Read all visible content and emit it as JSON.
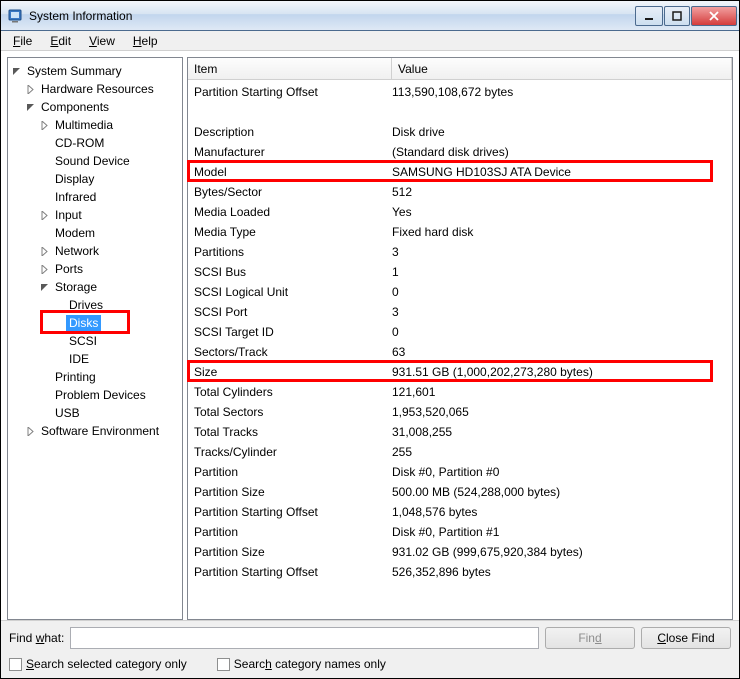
{
  "window": {
    "title": "System Information"
  },
  "menu": [
    "File",
    "Edit",
    "View",
    "Help"
  ],
  "tree": [
    {
      "label": "System Summary",
      "indent": 0,
      "expand": "open"
    },
    {
      "label": "Hardware Resources",
      "indent": 1,
      "expand": "closed"
    },
    {
      "label": "Components",
      "indent": 1,
      "expand": "open"
    },
    {
      "label": "Multimedia",
      "indent": 2,
      "expand": "closed"
    },
    {
      "label": "CD-ROM",
      "indent": 2,
      "expand": "none"
    },
    {
      "label": "Sound Device",
      "indent": 2,
      "expand": "none"
    },
    {
      "label": "Display",
      "indent": 2,
      "expand": "none"
    },
    {
      "label": "Infrared",
      "indent": 2,
      "expand": "none"
    },
    {
      "label": "Input",
      "indent": 2,
      "expand": "closed"
    },
    {
      "label": "Modem",
      "indent": 2,
      "expand": "none"
    },
    {
      "label": "Network",
      "indent": 2,
      "expand": "closed"
    },
    {
      "label": "Ports",
      "indent": 2,
      "expand": "closed"
    },
    {
      "label": "Storage",
      "indent": 2,
      "expand": "open"
    },
    {
      "label": "Drives",
      "indent": 3,
      "expand": "none"
    },
    {
      "label": "Disks",
      "indent": 3,
      "expand": "none",
      "selected": true
    },
    {
      "label": "SCSI",
      "indent": 3,
      "expand": "none"
    },
    {
      "label": "IDE",
      "indent": 3,
      "expand": "none"
    },
    {
      "label": "Printing",
      "indent": 2,
      "expand": "none"
    },
    {
      "label": "Problem Devices",
      "indent": 2,
      "expand": "none"
    },
    {
      "label": "USB",
      "indent": 2,
      "expand": "none"
    },
    {
      "label": "Software Environment",
      "indent": 1,
      "expand": "closed"
    }
  ],
  "columns": {
    "item": "Item",
    "value": "Value"
  },
  "rows": [
    {
      "item": "Partition Starting Offset",
      "value": "113,590,108,672 bytes"
    },
    {
      "blank": true
    },
    {
      "item": "Description",
      "value": "Disk drive"
    },
    {
      "item": "Manufacturer",
      "value": "(Standard disk drives)"
    },
    {
      "item": "Model",
      "value": "SAMSUNG HD103SJ ATA Device",
      "hl": "model"
    },
    {
      "item": "Bytes/Sector",
      "value": "512"
    },
    {
      "item": "Media Loaded",
      "value": "Yes"
    },
    {
      "item": "Media Type",
      "value": "Fixed hard disk"
    },
    {
      "item": "Partitions",
      "value": "3"
    },
    {
      "item": "SCSI Bus",
      "value": "1"
    },
    {
      "item": "SCSI Logical Unit",
      "value": "0"
    },
    {
      "item": "SCSI Port",
      "value": "3"
    },
    {
      "item": "SCSI Target ID",
      "value": "0"
    },
    {
      "item": "Sectors/Track",
      "value": "63"
    },
    {
      "item": "Size",
      "value": "931.51 GB (1,000,202,273,280 bytes)",
      "hl": "size"
    },
    {
      "item": "Total Cylinders",
      "value": "121,601"
    },
    {
      "item": "Total Sectors",
      "value": "1,953,520,065"
    },
    {
      "item": "Total Tracks",
      "value": "31,008,255"
    },
    {
      "item": "Tracks/Cylinder",
      "value": "255"
    },
    {
      "item": "Partition",
      "value": "Disk #0, Partition #0"
    },
    {
      "item": "Partition Size",
      "value": "500.00 MB (524,288,000 bytes)"
    },
    {
      "item": "Partition Starting Offset",
      "value": "1,048,576 bytes"
    },
    {
      "item": "Partition",
      "value": "Disk #0, Partition #1"
    },
    {
      "item": "Partition Size",
      "value": "931.02 GB (999,675,920,384 bytes)"
    },
    {
      "item": "Partition Starting Offset",
      "value": "526,352,896 bytes"
    }
  ],
  "search": {
    "find_what_label": "Find what:",
    "find_value": "",
    "find_btn": "Find",
    "close_btn": "Close Find",
    "chk_selected": "Search selected category only",
    "chk_names": "Search category names only"
  }
}
